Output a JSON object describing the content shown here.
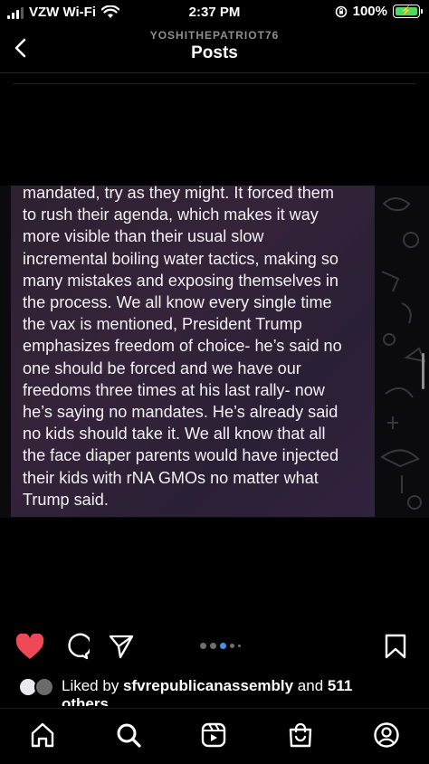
{
  "status_bar": {
    "carrier": "VZW Wi-Fi",
    "time": "2:37 PM",
    "battery": "100%"
  },
  "header": {
    "username": "YOSHITHEPATRIOT76",
    "title": "Posts"
  },
  "post": {
    "text": "mandated, try as they might. It forced them\nto rush their agenda, which makes it way\nmore visible than their usual slow\nincremental boiling water tactics, making so\nmany mistakes and exposing themselves in\nthe process. We all know every single time\nthe vax is mentioned, President Trump\nemphasizes freedom of choice- he’s said no\none should be forced and we have our\nfreedoms three times at his last rally- now\nhe’s saying no mandates.  He’s already said\nno kids should take it. We all know that all\nthe face diaper parents would have injected\ntheir kids with rNA GMOs no matter what\nTrump said.",
    "liked": true,
    "carousel_pages": 5,
    "carousel_active": 3
  },
  "likes": {
    "prefix": "Liked by ",
    "user": "sfvrepublicanassembly",
    "middle": " and ",
    "count": "511",
    "suffix": "others"
  },
  "colors": {
    "like_red": "#ed4956",
    "battery_green": "#4cd964",
    "muted": "#8e8e8e"
  },
  "icons": [
    "back-chevron-icon",
    "heart-icon",
    "comment-icon",
    "share-icon",
    "save-icon",
    "home-icon",
    "search-icon",
    "reels-icon",
    "shop-icon",
    "profile-icon"
  ]
}
